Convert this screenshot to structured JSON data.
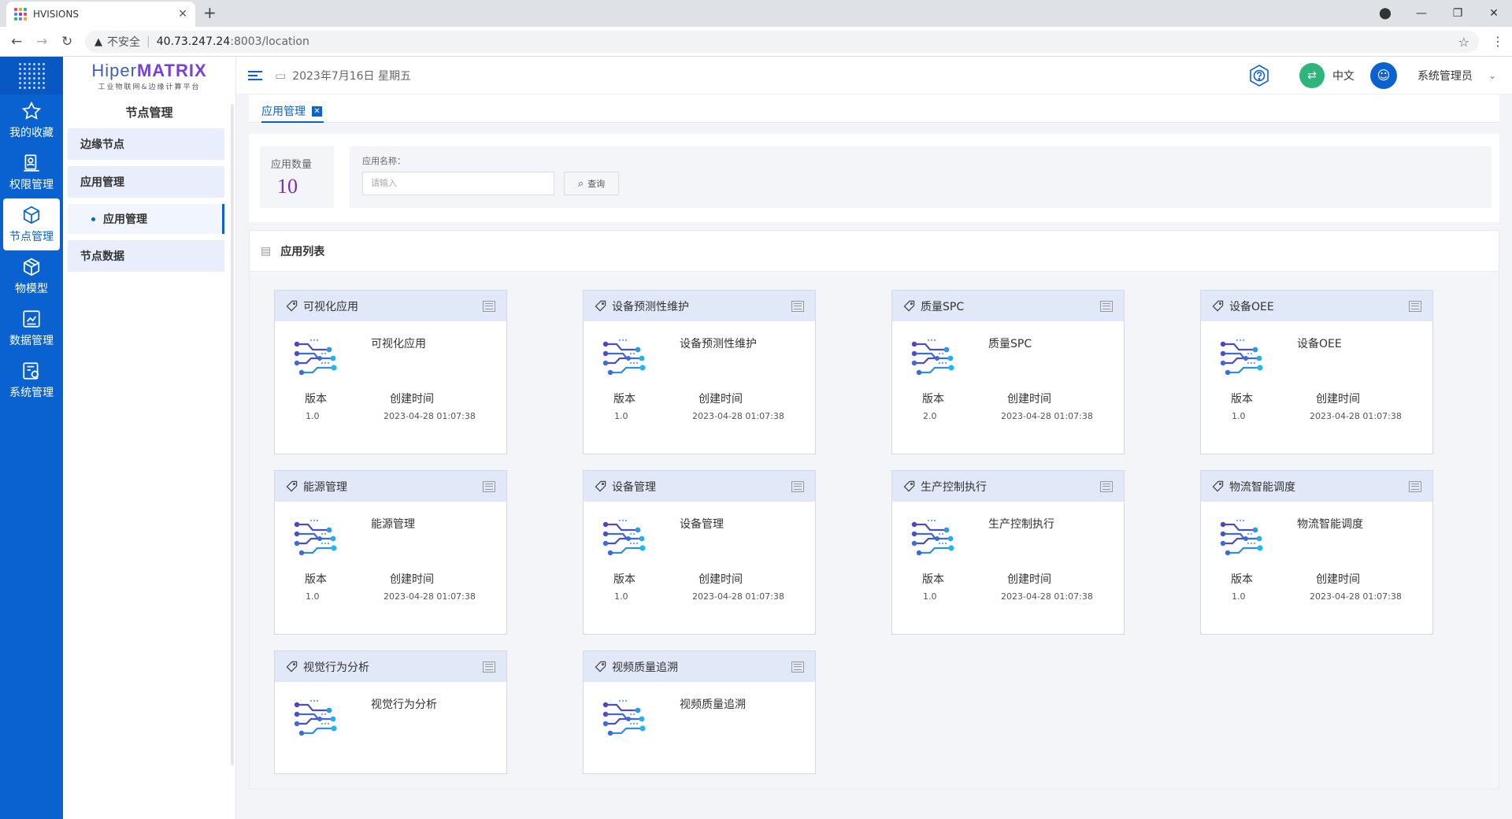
{
  "browser": {
    "tab_title": "HVISIONS",
    "insecure_label": "不安全",
    "url_host": "40.73.247.24",
    "url_path": ":8003/location"
  },
  "brand": {
    "name_a": "Hiper",
    "name_b": "MATRIX",
    "subtitle": "工业物联网&边缘计算平台"
  },
  "rail": {
    "items": [
      {
        "label": "我的收藏",
        "icon": "star-icon"
      },
      {
        "label": "权限管理",
        "icon": "shield-user-icon"
      },
      {
        "label": "节点管理",
        "icon": "cube-icon"
      },
      {
        "label": "物模型",
        "icon": "box-icon"
      },
      {
        "label": "数据管理",
        "icon": "chart-icon"
      },
      {
        "label": "系统管理",
        "icon": "settings-list-icon"
      }
    ]
  },
  "submenu": {
    "title": "节点管理",
    "items": [
      "边缘节点",
      "应用管理",
      "应用管理",
      "节点数据"
    ]
  },
  "header": {
    "date": "2023年7月16日 星期五",
    "language": "中文",
    "username": "系统管理员"
  },
  "tabs": {
    "active": "应用管理"
  },
  "filter": {
    "count_label": "应用数量",
    "count_value": "10",
    "name_label": "应用名称：",
    "name_placeholder": "请输入",
    "search_label": "查询"
  },
  "list": {
    "title": "应用列表",
    "version_label": "版本",
    "time_label": "创建时间",
    "apps": [
      {
        "name": "可视化应用",
        "version": "1.0",
        "created": "2023-04-28 01:07:38"
      },
      {
        "name": "设备预测性维护",
        "version": "1.0",
        "created": "2023-04-28 01:07:38"
      },
      {
        "name": "质量SPC",
        "version": "2.0",
        "created": "2023-04-28 01:07:38"
      },
      {
        "name": "设备OEE",
        "version": "1.0",
        "created": "2023-04-28 01:07:38"
      },
      {
        "name": "能源管理",
        "version": "1.0",
        "created": "2023-04-28 01:07:38"
      },
      {
        "name": "设备管理",
        "version": "1.0",
        "created": "2023-04-28 01:07:38"
      },
      {
        "name": "生产控制执行",
        "version": "1.0",
        "created": "2023-04-28 01:07:38"
      },
      {
        "name": "物流智能调度",
        "version": "1.0",
        "created": "2023-04-28 01:07:38"
      },
      {
        "name": "视觉行为分析",
        "version": "",
        "created": ""
      },
      {
        "name": "视频质量追溯",
        "version": "",
        "created": ""
      }
    ]
  },
  "colors": {
    "primary": "#0a62d1",
    "count_value": "#7a2fb6",
    "card_header": "#e1e8f8"
  }
}
